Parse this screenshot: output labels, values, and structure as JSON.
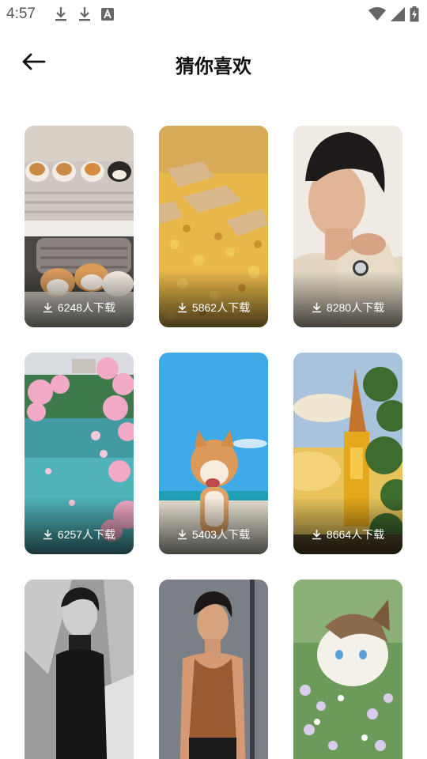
{
  "status": {
    "time": "4:57",
    "left_icons": [
      "download-icon",
      "download-icon",
      "font-a-icon"
    ],
    "right_icons": [
      "wifi-icon",
      "signal-icon",
      "battery-charging-icon"
    ]
  },
  "header": {
    "title": "猜你喜欢",
    "back_icon": "arrow-left-icon"
  },
  "cards": [
    {
      "downloads": "6248人下载",
      "theme": "shiba-plushies"
    },
    {
      "downloads": "5862人下载",
      "theme": "golden-leaves"
    },
    {
      "downloads": "8280人下载",
      "theme": "portrait-man"
    },
    {
      "downloads": "6257人下载",
      "theme": "cherry-blossom-lake"
    },
    {
      "downloads": "5403人下载",
      "theme": "shiba-beach"
    },
    {
      "downloads": "8664人下载",
      "theme": "tower-sky"
    },
    {
      "downloads": "",
      "theme": "mono-portrait"
    },
    {
      "downloads": "",
      "theme": "tank-top-portrait"
    },
    {
      "downloads": "",
      "theme": "cat-flowers"
    }
  ],
  "colors": {
    "accent": "#111111",
    "overlay_text": "#ffffff"
  }
}
